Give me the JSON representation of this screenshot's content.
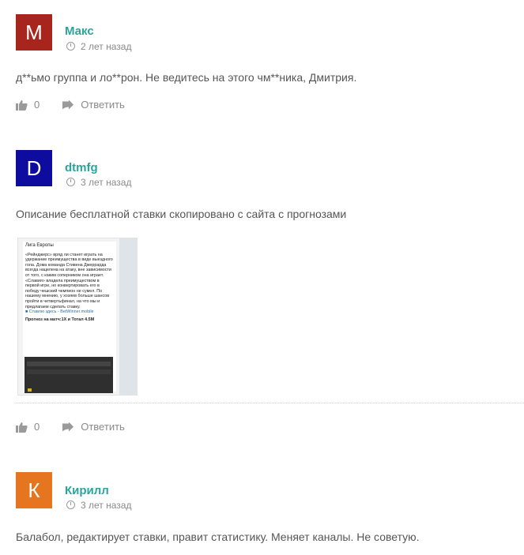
{
  "comments": [
    {
      "avatar_letter": "M",
      "avatar_color": "#a8251d",
      "author": "Макс",
      "time": "2 лет назад",
      "text": "д**ьмо группа и ло**рон. Не ведитесь на этого чм**ника, Дмитрия.",
      "likes": "0",
      "reply": "Ответить"
    },
    {
      "avatar_letter": "D",
      "avatar_color": "#0d0c9e",
      "author": "dtmfg",
      "time": "3 лет назад",
      "text": "Описание бесплатной ставки скопировано с сайта с прогнозами",
      "likes": "0",
      "reply": "Ответить",
      "attachment": {
        "heading": "Лига Европы",
        "body": "«Рейнджерс» вряд ли станет играть на удержание преимущества в виде выездного гола. Дома команда Стивена Джеррарда всегда нацелена на атаку, вне зависимости от того, с каким соперником она играет. «Славия» владела преимуществом в первой игре, но конвертировать его в победу чешский чемпион не сумел. По нашему мнению, у хозяев больше шансов пройти в четвертьфинал, на что мы и предлагаем сделать ставку.",
        "link_text": "■ Ставлю здесь - BetWinner.mobile",
        "forecast": "Прогноз на матч:1Х и Тотал 4.5М"
      }
    },
    {
      "avatar_letter": "К",
      "avatar_color": "#e5751e",
      "author": "Кирилл",
      "time": "3 лет назад",
      "text": "Балабол, редактирует ставки, правит статистику. Меняет каналы. Не советую."
    }
  ]
}
